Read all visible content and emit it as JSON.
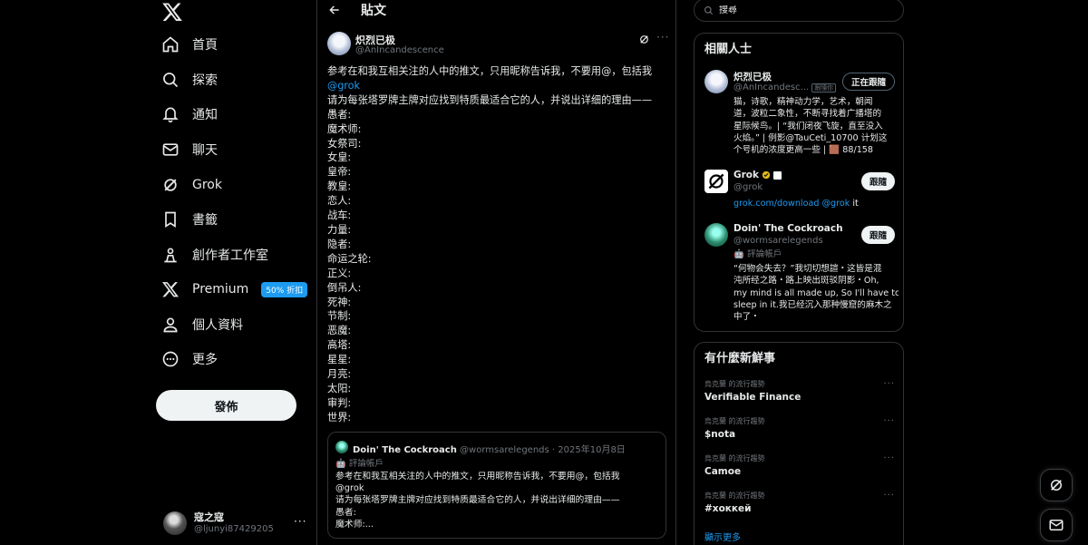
{
  "nav": {
    "items": [
      {
        "label": "首頁",
        "icon": "home-icon"
      },
      {
        "label": "探索",
        "icon": "search-icon"
      },
      {
        "label": "通知",
        "icon": "bell-icon"
      },
      {
        "label": "聊天",
        "icon": "mail-icon"
      },
      {
        "label": "Grok",
        "icon": "grok-icon"
      },
      {
        "label": "書籤",
        "icon": "bookmark-icon"
      },
      {
        "label": "創作者工作室",
        "icon": "creator-studio-icon"
      },
      {
        "label": "Premium",
        "icon": "x-premium-icon",
        "badge": "50% 折扣"
      },
      {
        "label": "個人資料",
        "icon": "person-icon"
      },
      {
        "label": "更多",
        "icon": "more-circle-icon"
      }
    ],
    "post_button": "發佈",
    "account": {
      "name": "寇之寇",
      "handle": "@ljunyi87429205",
      "more": "···"
    }
  },
  "main": {
    "header_title": "貼文",
    "tweet": {
      "author_name": "炽烈已极",
      "author_handle": "@AnIncandescence",
      "more": "···",
      "lines": [
        "参考在和我互相关注的人中的推文，只用昵称告诉我，不要用@，包括我",
        "@grok",
        "请为每张塔罗牌主牌对应找到特质最适合它的人，并说出详细的理由——",
        "愚者:",
        "魔术师:",
        "女祭司:",
        "女皇:",
        "皇帝:",
        "教皇:",
        "恋人:",
        "战车:",
        "力量:",
        "隐者:",
        "命运之轮:",
        "正义:",
        "倒吊人:",
        "死神:",
        "节制:",
        "恶魔:",
        "高塔:",
        "星星:",
        "月亮:",
        "太阳:",
        "审判:",
        "世界:"
      ],
      "quote": {
        "name": "Doin' The Cockroach",
        "meta": "@wormsarelegends · 2025年10月8日",
        "auto_label": "🤖 評論帳戶",
        "lines": [
          "参考在和我互相关注的人中的推文，只用昵称告诉我，不要用@，包括我",
          "@grok",
          "请为每张塔罗牌主牌对应找到特质最适合它的人，并说出详细的理由——",
          "愚者:",
          "魔术师:..."
        ]
      }
    }
  },
  "right": {
    "search_placeholder": "搜尋",
    "related": {
      "title": "相關人士",
      "people": [
        {
          "name": "炽烈已极",
          "handle": "@AnIncandesc...",
          "badge": "跟隨你",
          "button": "正在跟隨",
          "bio": [
            "猫，诗歌，精神动力学，艺术，朝闻",
            "道，波粒二象性，不断寻找着广播塔的",
            "星际候鸟。| “我们闭夜飞旋，直至没入",
            "火焰。” | 例影@TauCeti_10700 计划这",
            "个号机的浓度更高一些 | 🟫 88/158"
          ]
        },
        {
          "name": "Grok",
          "handle": "@grok",
          "button": "跟隨",
          "bio_link": "grok.com/download @grok",
          "bio_tail": " it"
        },
        {
          "name": "Doin' The Cockroach",
          "handle": "@wormsarelegends",
          "auto_label": "🤖 評論帳戶",
          "button": "跟隨",
          "bio": [
            "“何物会失去？”我切切想諠・这皆是混",
            "沌所经之路・路上映出斑驳阴影・Oh,",
            "my mind is all made up, So I'll have to",
            "sleep in it.我已经沉入那种慢窟的麻木之",
            "中了・"
          ]
        }
      ]
    },
    "trends": {
      "title": "有什麼新鮮事",
      "items": [
        {
          "category": "烏克蘭 的流行趨勢",
          "name": "Verifiable Finance"
        },
        {
          "category": "烏克蘭 的流行趨勢",
          "name": "$nota"
        },
        {
          "category": "烏克蘭 的流行趨勢",
          "name": "Camoe"
        },
        {
          "category": "烏克蘭 的流行趨勢",
          "name": "#хоккей"
        }
      ],
      "show_more": "顯示更多",
      "more": "···"
    }
  },
  "colors": {
    "accent": "#1d9bf0",
    "bg": "#000000",
    "border": "#2f3336",
    "muted": "#71767b"
  }
}
